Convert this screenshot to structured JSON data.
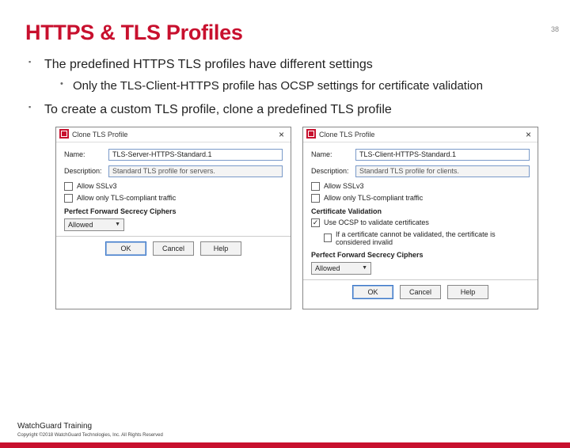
{
  "page_number": "38",
  "title": "HTTPS & TLS Profiles",
  "bullets": {
    "b1a": "The predefined HTTPS TLS profiles have different settings",
    "b2a": "Only the TLS-Client-HTTPS profile has OCSP settings for certificate validation",
    "b1b": "To create a custom TLS profile, clone a predefined TLS profile"
  },
  "dialogs": {
    "left": {
      "title": "Clone TLS Profile",
      "name_label": "Name:",
      "name_value": "TLS-Server-HTTPS-Standard.1",
      "desc_label": "Description:",
      "desc_value": "Standard TLS profile for servers.",
      "allow_sslv3": "Allow SSLv3",
      "allow_tls_compliant": "Allow only TLS-compliant traffic",
      "pfs_header": "Perfect Forward Secrecy Ciphers",
      "pfs_value": "Allowed",
      "ok": "OK",
      "cancel": "Cancel",
      "help": "Help"
    },
    "right": {
      "title": "Clone TLS Profile",
      "name_label": "Name:",
      "name_value": "TLS-Client-HTTPS-Standard.1",
      "desc_label": "Description:",
      "desc_value": "Standard TLS profile for clients.",
      "allow_sslv3": "Allow SSLv3",
      "allow_tls_compliant": "Allow only TLS-compliant traffic",
      "cv_header": "Certificate Validation",
      "cv_ocsp": "Use OCSP to validate certificates",
      "cv_invalid": "If a certificate cannot be validated, the certificate is considered invalid",
      "pfs_header": "Perfect Forward Secrecy Ciphers",
      "pfs_value": "Allowed",
      "ok": "OK",
      "cancel": "Cancel",
      "help": "Help"
    }
  },
  "footer": {
    "brand": "WatchGuard Training",
    "copyright": "Copyright ©2018 WatchGuard Technologies, Inc. All Rights Reserved"
  }
}
